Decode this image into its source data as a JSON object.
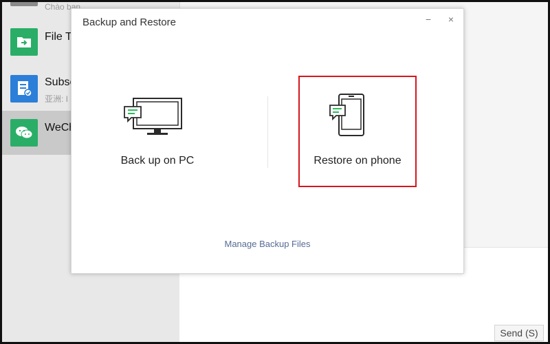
{
  "sidebar": {
    "items": [
      {
        "name": "",
        "sub": "Chào bạn",
        "icon": "user-avatar"
      },
      {
        "name": "File T",
        "sub": "",
        "icon": "file-transfer-icon"
      },
      {
        "name": "Subsc",
        "sub": "亚洲: I",
        "icon": "subscription-icon"
      },
      {
        "name": "WeCh",
        "sub": "",
        "icon": "wechat-icon"
      }
    ]
  },
  "dialog": {
    "title": "Backup and Restore",
    "minimize": "−",
    "close": "×",
    "options": [
      {
        "label": "Back up on PC",
        "icon": "monitor-icon"
      },
      {
        "label": "Restore on phone",
        "icon": "phone-icon"
      }
    ],
    "manage_link": "Manage Backup Files"
  },
  "chat": {
    "send_label": "Send (S)"
  },
  "colors": {
    "highlight": "#d4161c",
    "accent_green": "#07c160",
    "link": "#576b95"
  }
}
